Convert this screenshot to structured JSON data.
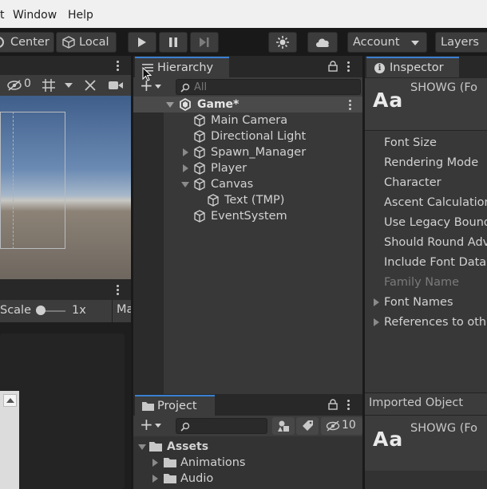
{
  "menubar": {
    "items": [
      "t",
      "Window",
      "Help"
    ]
  },
  "toolbar": {
    "center_label": "Center",
    "local_label": "Local",
    "account_label": "Account",
    "layers_label": "Layers"
  },
  "scene": {
    "gizmo_count": "0",
    "scale_label": "Scale",
    "scale_value": "1x",
    "ma_label": "Ma"
  },
  "hierarchy": {
    "tab_label": "Hierarchy",
    "search_placeholder": "All",
    "scene_name": "Game*",
    "items": [
      {
        "label": "Main Camera"
      },
      {
        "label": "Directional Light"
      },
      {
        "label": "Spawn_Manager"
      },
      {
        "label": "Player"
      },
      {
        "label": "Canvas"
      },
      {
        "label": "Text (TMP)"
      },
      {
        "label": "EventSystem"
      }
    ]
  },
  "inspector": {
    "tab_label": "Inspector",
    "asset_icon_text": "Aa",
    "asset_name": "SHOWG (Fo",
    "properties": [
      "Font Size",
      "Rendering Mode",
      "Character",
      "Ascent Calculation",
      "Use Legacy Bound",
      "Should Round Adv",
      "Include Font Data",
      "Family Name",
      "Font Names",
      "References to othe"
    ],
    "imported_object_label": "Imported Object",
    "imported_icon_text": "Aa",
    "imported_name": "SHOWG (Fo"
  },
  "project": {
    "tab_label": "Project",
    "hidden_count": "10",
    "folders": [
      "Assets",
      "Animations",
      "Audio"
    ]
  }
}
